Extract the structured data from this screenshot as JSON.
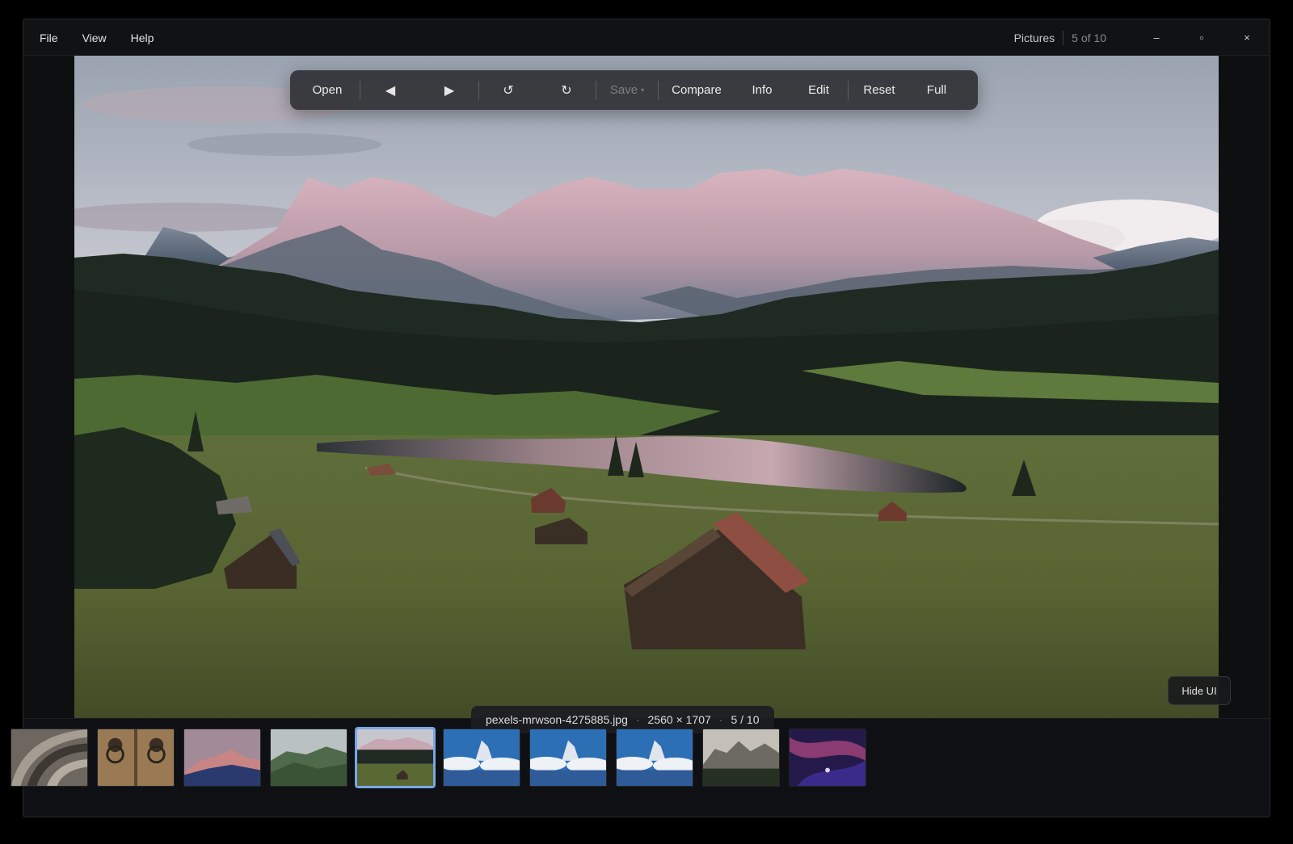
{
  "menu": {
    "items": [
      {
        "label": "File"
      },
      {
        "label": "View"
      },
      {
        "label": "Help"
      }
    ]
  },
  "titlebar": {
    "title": "Pictures",
    "position": "5 of 10",
    "minimize_icon": "minimize-icon",
    "maximize_icon": "maximize-icon",
    "close_icon": "close-icon",
    "minimize_glyph": "–",
    "maximize_glyph": "▫",
    "close_glyph": "×"
  },
  "toolbar": {
    "open": "Open",
    "prev_glyph": "◀",
    "next_glyph": "▶",
    "rotate_left_glyph": "↺",
    "rotate_right_glyph": "↻",
    "save": "Save",
    "save_caret": "▾",
    "compare": "Compare",
    "info": "Info",
    "edit": "Edit",
    "reset": "Reset",
    "full": "Full"
  },
  "hide_ui": "Hide UI",
  "file_info": {
    "filename": "pexels-mrwson-4275885.jpg",
    "dimensions": "2560 × 1707",
    "index": "5 / 10",
    "separator": "·"
  },
  "thumbnails": [
    {
      "subject": "stone-arches",
      "active": false
    },
    {
      "subject": "door-knockers",
      "active": false
    },
    {
      "subject": "pink-mountain",
      "active": false
    },
    {
      "subject": "misty-forest-hills",
      "active": false
    },
    {
      "subject": "alpine-meadow-huts",
      "active": true
    },
    {
      "subject": "matterhorn-clouds",
      "active": false
    },
    {
      "subject": "matterhorn-clouds",
      "active": false
    },
    {
      "subject": "matterhorn-clouds",
      "active": false
    },
    {
      "subject": "rocky-peaks",
      "active": false
    },
    {
      "subject": "abstract-purple",
      "active": false
    }
  ],
  "colors": {
    "accent": "#7aa6e6",
    "window_bg": "#0e0f11",
    "toolbar_bg": "#2a2b2f"
  }
}
